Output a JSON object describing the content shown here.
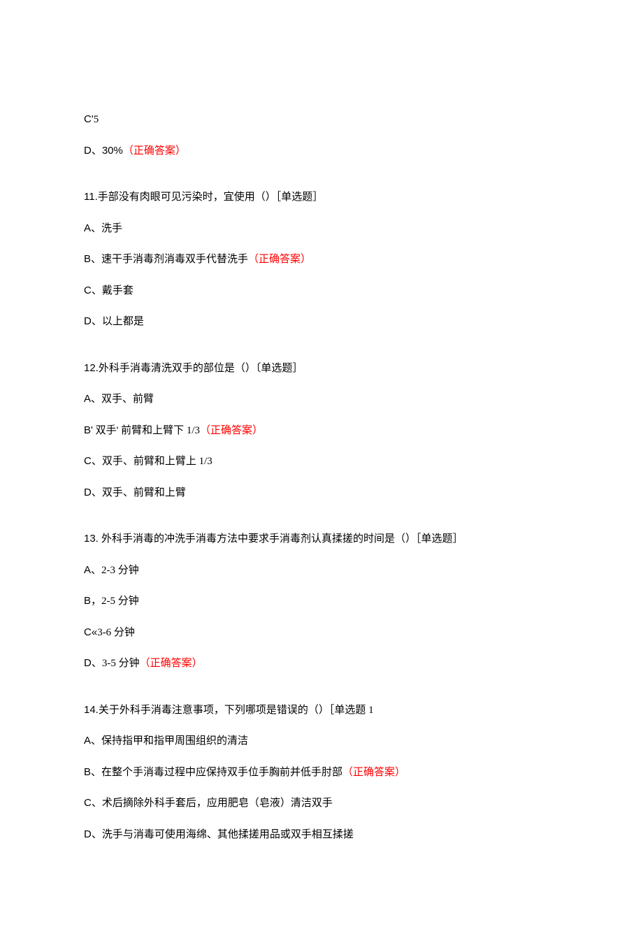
{
  "q10_partial": {
    "items": [
      {
        "prefix": "C'",
        "text": "5",
        "correct": false
      },
      {
        "prefix": "D、",
        "text": "30%",
        "correct": true
      }
    ]
  },
  "correct_label": "（正确答案）",
  "questions": [
    {
      "number": "11.",
      "stem": "手部没有肉眼可见污染时，宜使用（）［单选题］",
      "options": [
        {
          "prefix": "A、",
          "text": "洗手",
          "correct": false
        },
        {
          "prefix": "B、",
          "text": "速干手消毒剂消毒双手代替洗手",
          "correct": true
        },
        {
          "prefix": "C、",
          "text": "戴手套",
          "correct": false
        },
        {
          "prefix": "D、",
          "text": "以上都是",
          "correct": false
        }
      ]
    },
    {
      "number": "12.",
      "stem": "外科手消毒清洗双手的部位是（）〔单选题］",
      "options": [
        {
          "prefix": "A、",
          "text": "双手、前臂",
          "correct": false
        },
        {
          "prefix": "B'",
          "text": " 双手' 前臂和上臂下 1/3",
          "correct": true
        },
        {
          "prefix": "C、",
          "text": "双手、前臂和上臂上 1/3",
          "correct": false
        },
        {
          "prefix": "D、",
          "text": "双手、前臂和上臂",
          "correct": false
        }
      ]
    },
    {
      "number": "13. ",
      "stem": "外科手消毒的冲洗手消毒方法中要求手消毒剂认真揉搓的时间是（）［单选题］",
      "options": [
        {
          "prefix": "A、",
          "text": "2-3 分钟",
          "correct": false
        },
        {
          "prefix": "B，",
          "text": "2-5 分钟",
          "correct": false
        },
        {
          "prefix": "C«",
          "text": "3-6 分钟",
          "correct": false
        },
        {
          "prefix": "D、",
          "text": "3-5 分钟",
          "correct": true
        }
      ]
    },
    {
      "number": "14.",
      "stem": "关于外科手消毒注意事项，下列哪项是错误的（）［单选题 1",
      "options": [
        {
          "prefix": "A、",
          "text": "保持指甲和指甲周围组织的清洁",
          "correct": false
        },
        {
          "prefix": "B、",
          "text": "在整个手消毒过程中应保持双手位手胸前并低手肘部",
          "correct": true
        },
        {
          "prefix": "C、",
          "text": "术后摘除外科手套后，应用肥皂（皂液）清洁双手",
          "correct": false
        },
        {
          "prefix": "D、",
          "text": "洗手与消毒可使用海绵、其他揉搓用品或双手相互揉搓",
          "correct": false
        }
      ]
    }
  ]
}
